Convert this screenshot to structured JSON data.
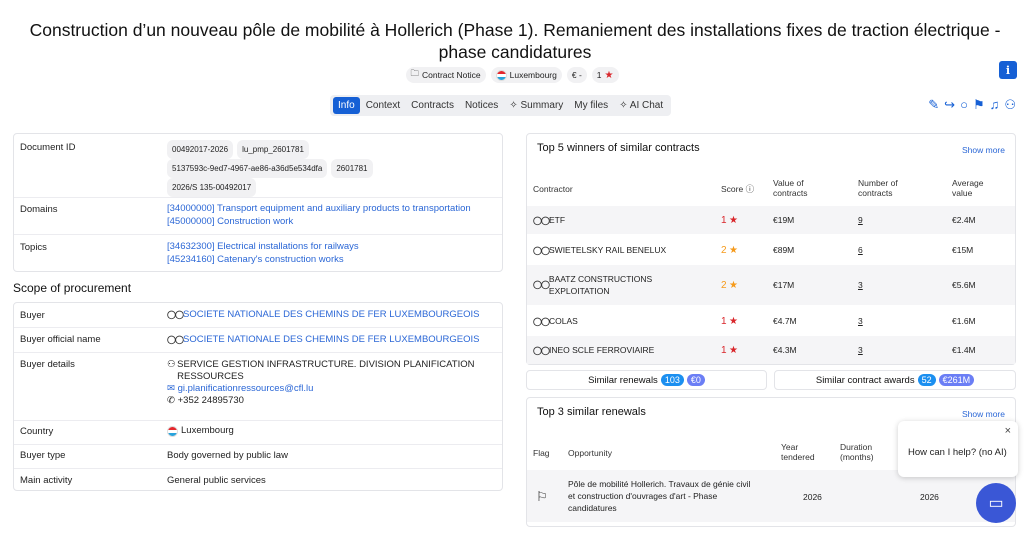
{
  "title": "Construction d’un nouveau pôle de mobilité à Hollerich (Phase 1). Remaniement des installations fixes de traction électrique - phase candidatures",
  "badges": {
    "notice": "Contract Notice",
    "country": "Luxembourg",
    "currency": "€ -",
    "score": "1"
  },
  "tabs": [
    "Info",
    "Context",
    "Contracts",
    "Notices",
    "Summary",
    "My files",
    "AI Chat"
  ],
  "details": {
    "document_id_label": "Document ID",
    "document_ids": [
      "00492017-2026",
      "lu_pmp_2601781",
      "5137593c-9ed7-4967-ae86-a36d5e534dfa",
      "2601781",
      "2026/S 135-00492017"
    ],
    "domains_label": "Domains",
    "domains": [
      "[34000000] Transport equipment and auxiliary products to transportation",
      "[45000000] Construction work"
    ],
    "topics_label": "Topics",
    "topics": [
      "[34632300] Electrical installations for railways",
      "[45234160] Catenary's construction works"
    ]
  },
  "scope": {
    "heading": "Scope of procurement",
    "buyer_label": "Buyer",
    "buyer": "SOCIETE NATIONALE DES CHEMINS DE FER LUXEMBOURGEOIS",
    "buyer_official_label": "Buyer official name",
    "buyer_official": "SOCIETE NATIONALE DES CHEMINS DE FER LUXEMBOURGEOIS",
    "buyer_details_label": "Buyer details",
    "buyer_contact": "SERVICE GESTION INFRASTRUCTURE. DIVISION PLANIFICATION RESSOURCES",
    "buyer_email": "gi.planificationressources@cfl.lu",
    "buyer_phone": "+352 24895730",
    "country_label": "Country",
    "country": "Luxembourg",
    "buyer_type_label": "Buyer type",
    "buyer_type": "Body governed by public law",
    "main_activity_label": "Main activity",
    "main_activity": "General public services"
  },
  "winners": {
    "title": "Top 5 winners of similar contracts",
    "show_more": "Show more",
    "headers": {
      "contractor": "Contractor",
      "score": "Score",
      "value": "Value of contracts",
      "number": "Number of contracts",
      "average": "Average value"
    },
    "rows": [
      {
        "name": "ETF",
        "score": "1",
        "value": "€19M",
        "number": "9",
        "average": "€2.4M"
      },
      {
        "name": "SWIETELSKY RAIL BENELUX",
        "score": "2",
        "value": "€89M",
        "number": "6",
        "average": "€15M"
      },
      {
        "name": "BAATZ CONSTRUCTIONS EXPLOITATION",
        "score": "2",
        "value": "€17M",
        "number": "3",
        "average": "€5.6M"
      },
      {
        "name": "COLAS",
        "score": "1",
        "value": "€4.7M",
        "number": "3",
        "average": "€1.6M"
      },
      {
        "name": "INEO SCLE FERROVIAIRE",
        "score": "1",
        "value": "€4.3M",
        "number": "3",
        "average": "€1.4M"
      }
    ]
  },
  "stats": {
    "renewals_label": "Similar renewals",
    "renewals_count": "103",
    "renewals_value": "€0",
    "awards_label": "Similar contract awards",
    "awards_count": "52",
    "awards_value": "€261M"
  },
  "renewals": {
    "title": "Top 3 similar renewals",
    "show_more": "Show more",
    "headers": {
      "flag": "Flag",
      "opportunity": "Opportunity",
      "year": "Year tendered",
      "duration": "Duration (months)"
    },
    "row": {
      "opportunity": "Pôle de mobilité Hollerich. Travaux de génie civil et construction d'ouvrages d'art - Phase candidatures",
      "year": "2026",
      "last": "2026"
    }
  },
  "chat": {
    "prompt": "How can I help? (no AI)",
    "close": "×"
  }
}
